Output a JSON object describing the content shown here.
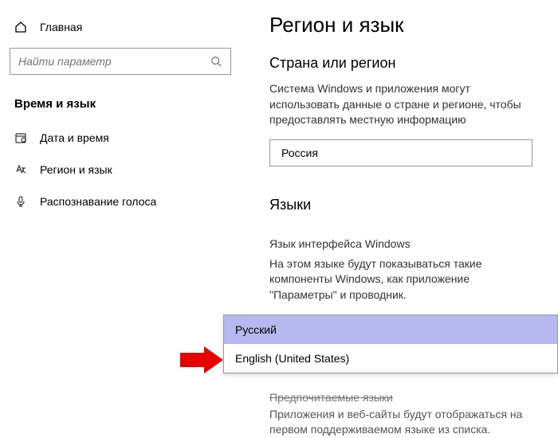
{
  "sidebar": {
    "home": "Главная",
    "search_placeholder": "Найти параметр",
    "section": "Время и язык",
    "items": [
      {
        "label": "Дата и время"
      },
      {
        "label": "Регион и язык"
      },
      {
        "label": "Распознавание голоса"
      }
    ]
  },
  "content": {
    "title": "Регион и язык",
    "region_heading": "Страна или регион",
    "region_desc": "Система Windows и приложения могут использовать данные о стране и регионе, чтобы предоставлять местную информацию",
    "region_value": "Россия",
    "lang_heading": "Языки",
    "lang_sub": "Язык интерфейса Windows",
    "lang_desc": "На этом языке будут показываться такие компоненты Windows, как приложение \"Параметры\" и проводник.",
    "dropdown_options": [
      "Русский",
      "English (United States)"
    ],
    "partial_heading": "Предпочитаемые языки",
    "partial_desc": "Приложения и веб-сайты будут отображаться на первом поддерживаемом языке из списка."
  }
}
